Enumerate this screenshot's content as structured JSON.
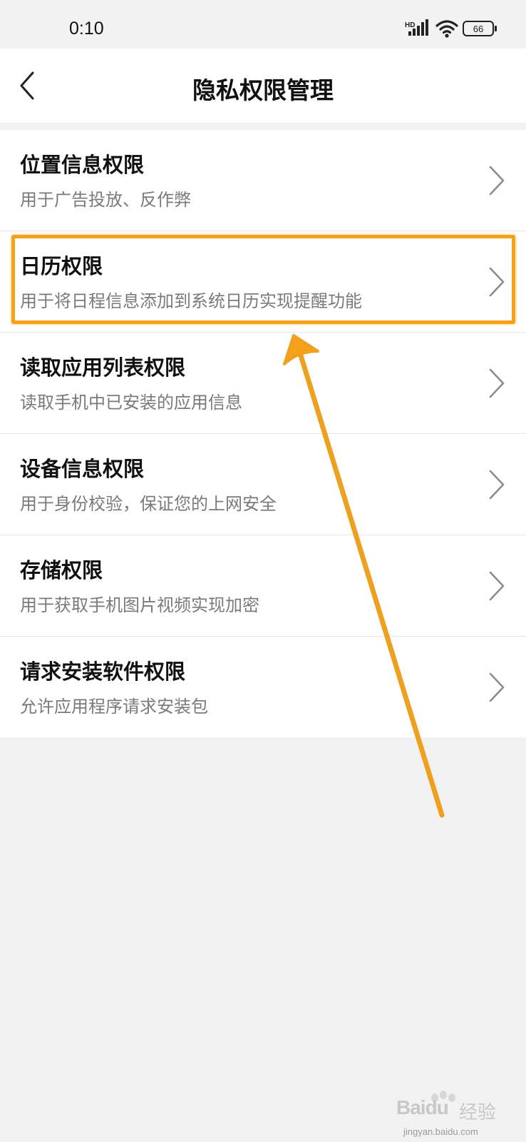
{
  "status_bar": {
    "time": "0:10",
    "network_label": "HD",
    "battery": "66",
    "icons": [
      "signal-icon",
      "wifi-icon",
      "battery-icon"
    ]
  },
  "header": {
    "title": "隐私权限管理",
    "back_icon": "chevron-left-icon"
  },
  "permissions": [
    {
      "title": "位置信息权限",
      "desc": "用于广告投放、反作弊"
    },
    {
      "title": "日历权限",
      "desc": "用于将日程信息添加到系统日历实现提醒功能"
    },
    {
      "title": "读取应用列表权限",
      "desc": "读取手机中已安装的应用信息"
    },
    {
      "title": "设备信息权限",
      "desc": "用于身份校验，保证您的上网安全"
    },
    {
      "title": "存储权限",
      "desc": "用于获取手机图片视频实现加密"
    },
    {
      "title": "请求安装软件权限",
      "desc": "允许应用程序请求安装包"
    }
  ],
  "annotation": {
    "highlighted_item_index": 1,
    "color": "#f5a11a"
  },
  "watermark": {
    "logo_text": "Baidu",
    "cn_text": "经验",
    "url": "jingyan.baidu.com"
  },
  "colors": {
    "background": "#f2f2f2",
    "card": "#ffffff",
    "title": "#111111",
    "desc": "#7a7a7a",
    "accent": "#f5a11a"
  }
}
